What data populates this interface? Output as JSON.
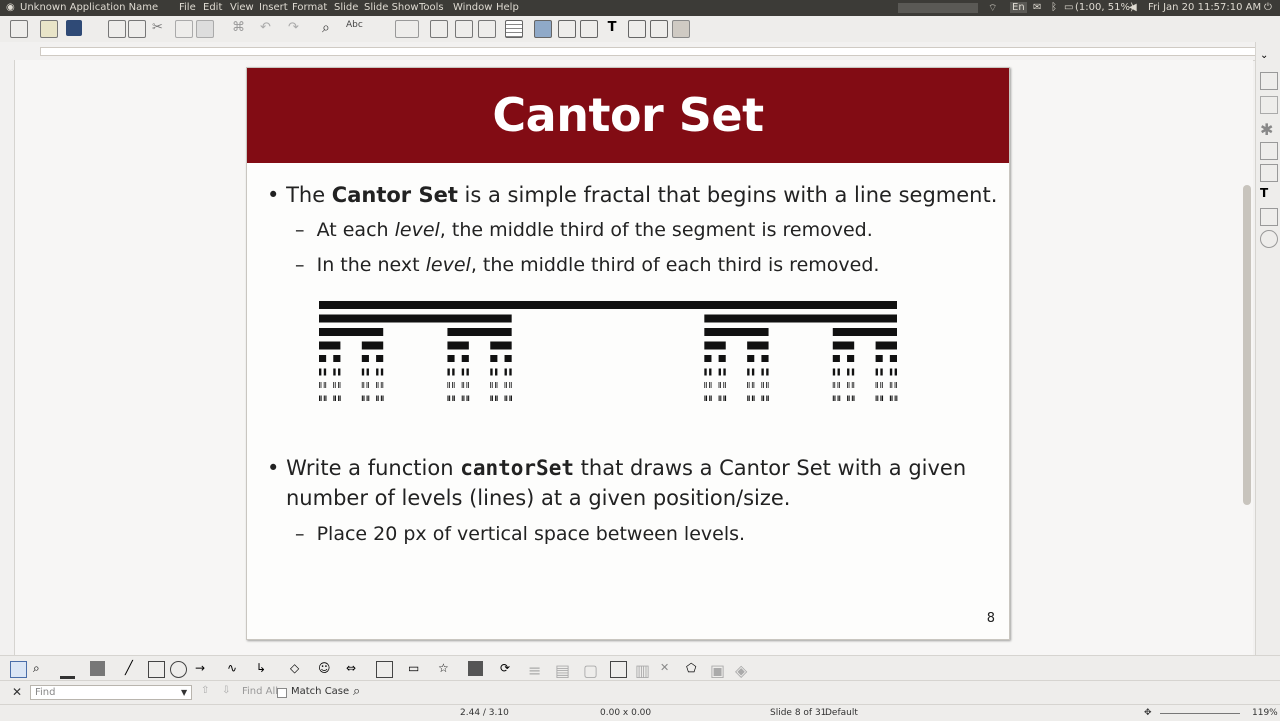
{
  "app": {
    "title": "Unknown Application Name",
    "menu": [
      "File",
      "Edit",
      "View",
      "Insert",
      "Format",
      "Slide",
      "Slide Show",
      "Tools",
      "Window",
      "Help"
    ],
    "tray": {
      "battery": "(1:00, 51%)",
      "clock": "Fri Jan 20   11:57:10 AM",
      "keyboard": "En"
    }
  },
  "slide": {
    "title": "Cantor Set",
    "number": "8",
    "bullet1": {
      "pre": "The ",
      "bold": "Cantor Set",
      "post": " is a simple fractal that begins with a line segment.",
      "sub1": {
        "pre": "At each ",
        "em": "level",
        "post": ", the middle third of the segment is removed."
      },
      "sub2": {
        "pre": "In the next ",
        "em": "level",
        "post": ", the middle third of each third is removed."
      }
    },
    "bullet2": {
      "pre": "Write a function ",
      "code": "cantorSet",
      "post": " that draws a Cantor Set with a given",
      "line2": "number of levels (lines) at a given position/size.",
      "sub1": "Place 20 px of vertical space between levels."
    },
    "cantor_levels": 8
  },
  "findbar": {
    "placeholder": "Find",
    "find_all": "Find All",
    "match_case": "Match Case"
  },
  "status": {
    "position": "2.44 / 3.10",
    "size": "0.00 x 0.00",
    "slide": "Slide 8 of 31",
    "layout": "Default",
    "zoom": "119%"
  },
  "colors": {
    "header": "#820c14",
    "menubar": "#3c3b37"
  }
}
